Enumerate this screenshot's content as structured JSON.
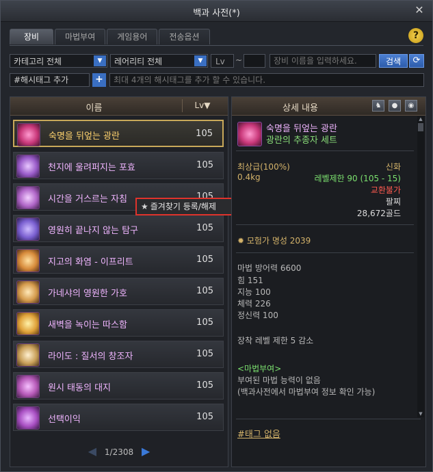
{
  "window": {
    "title": "백과 사전(*)"
  },
  "tabs": [
    {
      "label": "장비",
      "active": true
    },
    {
      "label": "마법부여",
      "active": false
    },
    {
      "label": "게임용어",
      "active": false
    },
    {
      "label": "전송옵션",
      "active": false
    }
  ],
  "filters": {
    "category": "카테고리 전체",
    "rarity": "레어리티 전체",
    "lv_label": "Lv",
    "lv_tilde": "~",
    "name_placeholder": "장비 이름을 입력하세요.",
    "search_label": "검색",
    "hashtag_add": "#해시태그 추가",
    "hashtag_placeholder": "최대 4개의 해시태그를 추가 할 수 있습니다."
  },
  "list": {
    "header_name": "이름",
    "header_lv": "Lv▼",
    "items": [
      {
        "name": "숙명을 뒤엎는 광란",
        "lv": "105",
        "icon_color": "#c9387a"
      },
      {
        "name": "천지에 울려퍼지는 포효",
        "lv": "105",
        "icon_color": "#9a5cc9"
      },
      {
        "name": "시간을 거스르는 자침",
        "lv": "105",
        "icon_color": "#b066c8"
      },
      {
        "name": "영원히 끝나지 않는 탐구",
        "lv": "105",
        "icon_color": "#7a5fd0"
      },
      {
        "name": "지고의 화염 - 이프리트",
        "lv": "105",
        "icon_color": "#d68a3a"
      },
      {
        "name": "가네샤의 영원한 가호",
        "lv": "105",
        "icon_color": "#d49a4c"
      },
      {
        "name": "새벽을 녹이는 따스함",
        "lv": "105",
        "icon_color": "#e0a23a"
      },
      {
        "name": "라이도 : 질서의 창조자",
        "lv": "105",
        "icon_color": "#c9a05a"
      },
      {
        "name": "원시 태동의 대지",
        "lv": "105",
        "icon_color": "#b65ab8"
      },
      {
        "name": "선택이익",
        "lv": "105",
        "icon_color": "#a84fc2"
      }
    ],
    "page": "1/2308"
  },
  "tooltip": {
    "text": "즐겨찾기 등록/해제"
  },
  "detail": {
    "header": "상세 내용",
    "item_name": "숙명을 뒤엎는 광란",
    "set_name": "광란의 추종자 세트",
    "grade": "최상급(100%)",
    "rarity": "신화",
    "weight": "0.4kg",
    "level_limit": "레벨제한 90 (105 - 15)",
    "trade": "교환불가",
    "slot": "팔찌",
    "price": "28,672골드",
    "fame": "모험가 명성 2039",
    "stats": [
      "마법 방어력 6600",
      "힘 151",
      "지능 100",
      "체력 226",
      "정신력 100"
    ],
    "level_reduce": "장착 레벨 제한 5 감소",
    "enchant_title": "<마법부여>",
    "enchant_line1": "부여된 마법 능력이 없음",
    "enchant_line2": "(백과사전에서 마법부여 정보 확인 가능)",
    "tags": "#태그 없음"
  },
  "colors": {
    "accent_blue": "#3a6fc2",
    "highlight_red": "#e0332c",
    "legendary_pink": "#f0b5ff",
    "set_green": "#8be07a"
  }
}
